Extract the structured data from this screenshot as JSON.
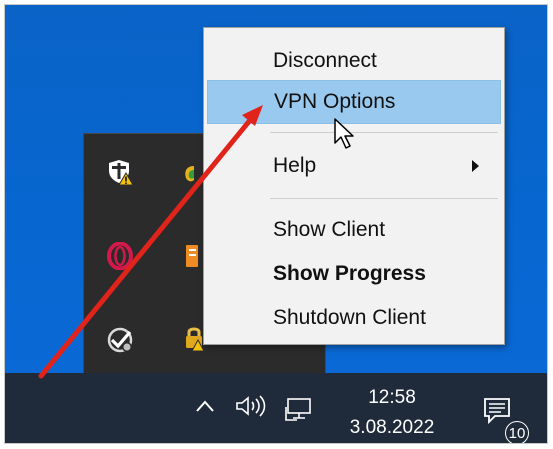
{
  "colors": {
    "desktop": "#0766cf",
    "menu_background": "#f2f2f2",
    "menu_highlight": "#99c9ef",
    "taskbar": "#1f2a3a",
    "tray_flyout": "#2b2b2b",
    "annotation_arrow": "#e0241b"
  },
  "context_menu": {
    "items": [
      {
        "label": "Disconnect",
        "bold": false,
        "highlighted": false,
        "submenu": false
      },
      {
        "label": "VPN Options",
        "bold": false,
        "highlighted": true,
        "submenu": false
      },
      {
        "label": "Help",
        "bold": false,
        "highlighted": false,
        "submenu": true
      },
      {
        "label": "Show Client",
        "bold": false,
        "highlighted": false,
        "submenu": false
      },
      {
        "label": "Show Progress",
        "bold": true,
        "highlighted": false,
        "submenu": false
      },
      {
        "label": "Shutdown Client",
        "bold": false,
        "highlighted": false,
        "submenu": false
      }
    ]
  },
  "tray_flyout": {
    "icons": [
      "windows-security-warning-icon",
      "green-app-icon",
      "opera-icon",
      "orange-app-icon",
      "vpn-client-icon",
      "lock-warning-icon"
    ]
  },
  "taskbar": {
    "icons": [
      "show-hidden-icons-chevron-icon",
      "speaker-icon",
      "network-icon",
      "action-center-icon"
    ],
    "clock_time": "12:58",
    "clock_date": "3.08.2022",
    "notification_count": "10"
  }
}
